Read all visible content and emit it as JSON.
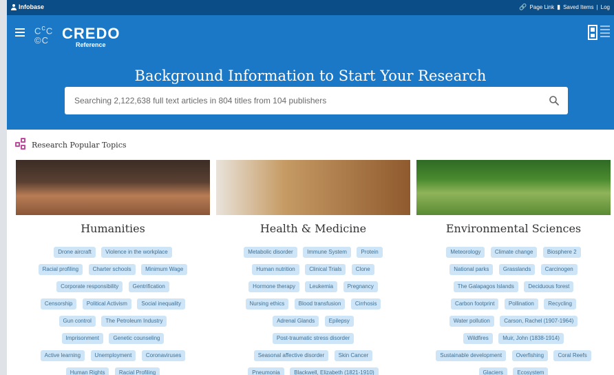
{
  "topbar": {
    "brand": "Infobase",
    "links": [
      "Page Link",
      "Saved Items",
      "Log"
    ]
  },
  "header": {
    "logo_word": "CREDO",
    "logo_sub": "Reference",
    "hero_title": "Background Information to Start Your Research",
    "search_placeholder": "Searching 2,122,638 full text articles in 804 titles from 104 publishers"
  },
  "topics": {
    "heading": "Research Popular Topics",
    "cards": [
      {
        "title": "Humanities",
        "tags": [
          "Drone aircraft",
          "Violence in the workplace",
          "Racial profiling",
          "Charter schools",
          "Minimum Wage",
          "Corporate responsibility",
          "Gentrification",
          "Censorship",
          "Political Activism",
          "Social inequality",
          "Gun control",
          "The Petroleum Industry",
          "Imprisonment",
          "Genetic counseling",
          "Active learning",
          "Unemployment",
          "Coronaviruses",
          "Human Rights",
          "Racial Profiling"
        ]
      },
      {
        "title": "Health & Medicine",
        "tags": [
          "Metabolic disorder",
          "Immune System",
          "Protein",
          "Human nutrition",
          "Clinical Trials",
          "Clone",
          "Hormone therapy",
          "Leukemia",
          "Pregnancy",
          "Nursing ethics",
          "Blood transfusion",
          "Cirrhosis",
          "Adrenal Glands",
          "Epilepsy",
          "Post-traumatic stress disorder",
          "Seasonal affective disorder",
          "Skin Cancer",
          "Pneumonia",
          "Blackwell, Elizabeth (1821-1910)"
        ]
      },
      {
        "title": "Environmental Sciences",
        "tags": [
          "Meteorology",
          "Climate change",
          "Biosphere 2",
          "National parks",
          "Grasslands",
          "Carcinogen",
          "The Galapagos Islands",
          "Deciduous forest",
          "Carbon footprint",
          "Pollination",
          "Recycling",
          "Water pollution",
          "Carson, Rachel (1907-1964)",
          "Wildfires",
          "Muir, John (1838-1914)",
          "Sustainable development",
          "Overfishing",
          "Coral Reefs",
          "Glaciers",
          "Ecosystem"
        ]
      }
    ]
  },
  "colors": {
    "header_blue": "#1a78c6",
    "top_strip": "#0b4d86",
    "tag_bg": "#cde5f6",
    "tag_text": "#3f6f95",
    "topic_icon": "#c04a9d"
  }
}
